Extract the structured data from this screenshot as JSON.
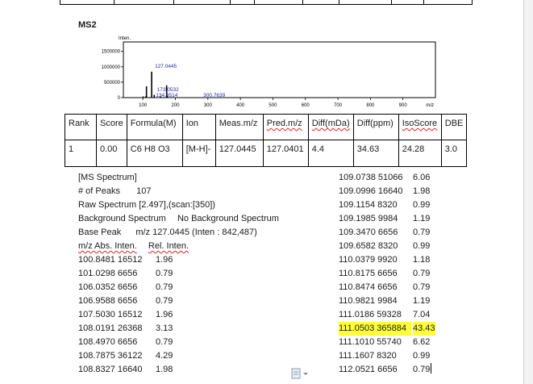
{
  "section_title": "MS2",
  "spectrum": {
    "y_axis_label": "Inten.",
    "y_ticks": [
      "1500000",
      "1000000",
      "500000",
      "0"
    ],
    "x_ticks": [
      "100",
      "200",
      "300",
      "400",
      "500",
      "600",
      "700",
      "800",
      "900"
    ],
    "x_unit": "m/z",
    "peak_labels": [
      "127.0445",
      "173.0532",
      "134.8514",
      "300.7639"
    ]
  },
  "chart_data": {
    "type": "bar",
    "xlabel": "m/z",
    "ylabel": "Inten.",
    "xlim": [
      40,
      1000
    ],
    "ylim": [
      0,
      1650000
    ],
    "peaks": [
      {
        "mz": 100.8481,
        "intensity": 38000
      },
      {
        "mz": 108.8327,
        "intensity": 40000
      },
      {
        "mz": 111.0503,
        "intensity": 365884
      },
      {
        "mz": 127.0445,
        "intensity": 842487
      },
      {
        "mz": 134.8514,
        "intensity": 90000
      },
      {
        "mz": 155.0,
        "intensity": 40000
      },
      {
        "mz": 173.0532,
        "intensity": 400000
      },
      {
        "mz": 175.0,
        "intensity": 60000
      },
      {
        "mz": 300.7639,
        "intensity": 12000
      }
    ]
  },
  "results_table": {
    "headers": [
      "Rank",
      "Score",
      "Formula(M)",
      "Ion",
      "Meas.m/z",
      "Pred.m/z",
      "Diff(mDa)",
      "Diff(ppm)",
      "IsoScore",
      "DBE"
    ],
    "rows": [
      [
        "1",
        "0.00",
        "C6 H8 O3",
        "[M-H]-",
        "127.0445",
        "127.0401",
        "4.4",
        "34.63",
        "24.28",
        "3.0"
      ]
    ]
  },
  "info": {
    "ms_spectrum": "[MS Spectrum]",
    "num_peaks_label": "# of Peaks",
    "num_peaks": "107",
    "raw_spectrum": "Raw Spectrum [2.497],(scan:[350])",
    "background_label": "Background Spectrum",
    "background_value": "No Background Spectrum",
    "base_peak_label": "Base Peak",
    "base_peak_value": "m/z 127.0445 (Inten : 842,487)",
    "col_header": "m/z  Abs. Inten.",
    "col_header_rel": "Rel. Inten."
  },
  "peak_list_left": [
    {
      "mz_abs": "100.8481 16512",
      "rel": "1.96"
    },
    {
      "mz_abs": "101.0298 6656",
      "rel": "0.79"
    },
    {
      "mz_abs": "106.0352 6656",
      "rel": "0.79"
    },
    {
      "mz_abs": "106.9588 6656",
      "rel": "0.79"
    },
    {
      "mz_abs": "107.5030 16512",
      "rel": "1.96"
    },
    {
      "mz_abs": "108.0191 26368",
      "rel": "3.13"
    },
    {
      "mz_abs": "108.4970 6656",
      "rel": "0.79"
    },
    {
      "mz_abs": "108.7875 36122",
      "rel": "4.29"
    },
    {
      "mz_abs": "108.8327 16640",
      "rel": "1.98"
    }
  ],
  "peak_list_right": [
    {
      "mz_abs": "109.0738 51066",
      "rel": "6.06"
    },
    {
      "mz_abs": "109.0996 16640",
      "rel": "1.98"
    },
    {
      "mz_abs": "109.1154 8320",
      "rel": "0.99"
    },
    {
      "mz_abs": "109.1985 9984",
      "rel": "1.19"
    },
    {
      "mz_abs": "109.3470 6656",
      "rel": "0.79"
    },
    {
      "mz_abs": "109.6582 8320",
      "rel": "0.99"
    },
    {
      "mz_abs": "110.0379 9920",
      "rel": "1.18"
    },
    {
      "mz_abs": "110.8175 6656",
      "rel": "0.79"
    },
    {
      "mz_abs": "110.8474 6656",
      "rel": "0.79"
    },
    {
      "mz_abs": "110.9821 9984",
      "rel": "1.19"
    },
    {
      "mz_abs": "111.0186 59328",
      "rel": "7.04"
    },
    {
      "mz_abs": "111.0503 365884",
      "rel": "43.43"
    },
    {
      "mz_abs": "111.1010 55740",
      "rel": "6.62"
    },
    {
      "mz_abs": "111.1607 8320",
      "rel": "0.99"
    },
    {
      "mz_abs": "112.0521 6656",
      "rel": "0.79"
    }
  ],
  "highlight_row_index": 11,
  "colors": {
    "highlight": "#ffff3a",
    "peak_label": "#1f2aa8",
    "spell_underline": "#dd2222"
  }
}
